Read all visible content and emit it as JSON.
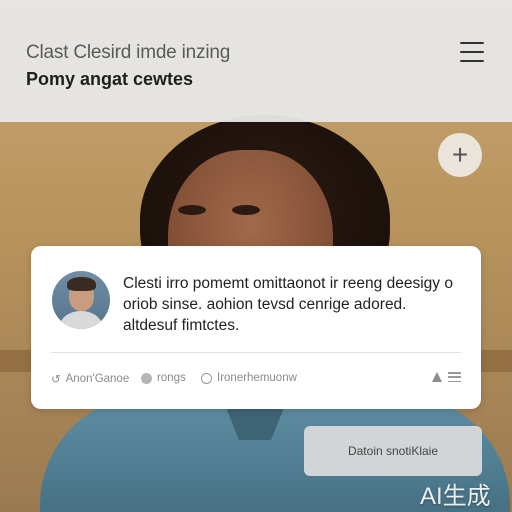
{
  "header": {
    "title": "Clast Clesird imde inzing",
    "subtitle": "Pomy angat cewtes",
    "menu_icon": "hamburger-menu-icon"
  },
  "fab": {
    "label": "+",
    "icon": "plus-icon"
  },
  "card": {
    "text": "Clesti irro pomemt omittaonot ir reeng deesigy o oriob sinse. aohion tevsd cenrige adored. altdesuf fimtctes.",
    "meta": [
      {
        "label": "Anon'Ganoe",
        "icon": "clock-icon"
      },
      {
        "label": "rongs",
        "icon": "dot-icon"
      },
      {
        "label": "Ironerhemuonw",
        "icon": "ring-icon"
      }
    ]
  },
  "action": {
    "label": "Datoin snotiKlaie"
  },
  "watermark": {
    "text": "AI生成"
  }
}
